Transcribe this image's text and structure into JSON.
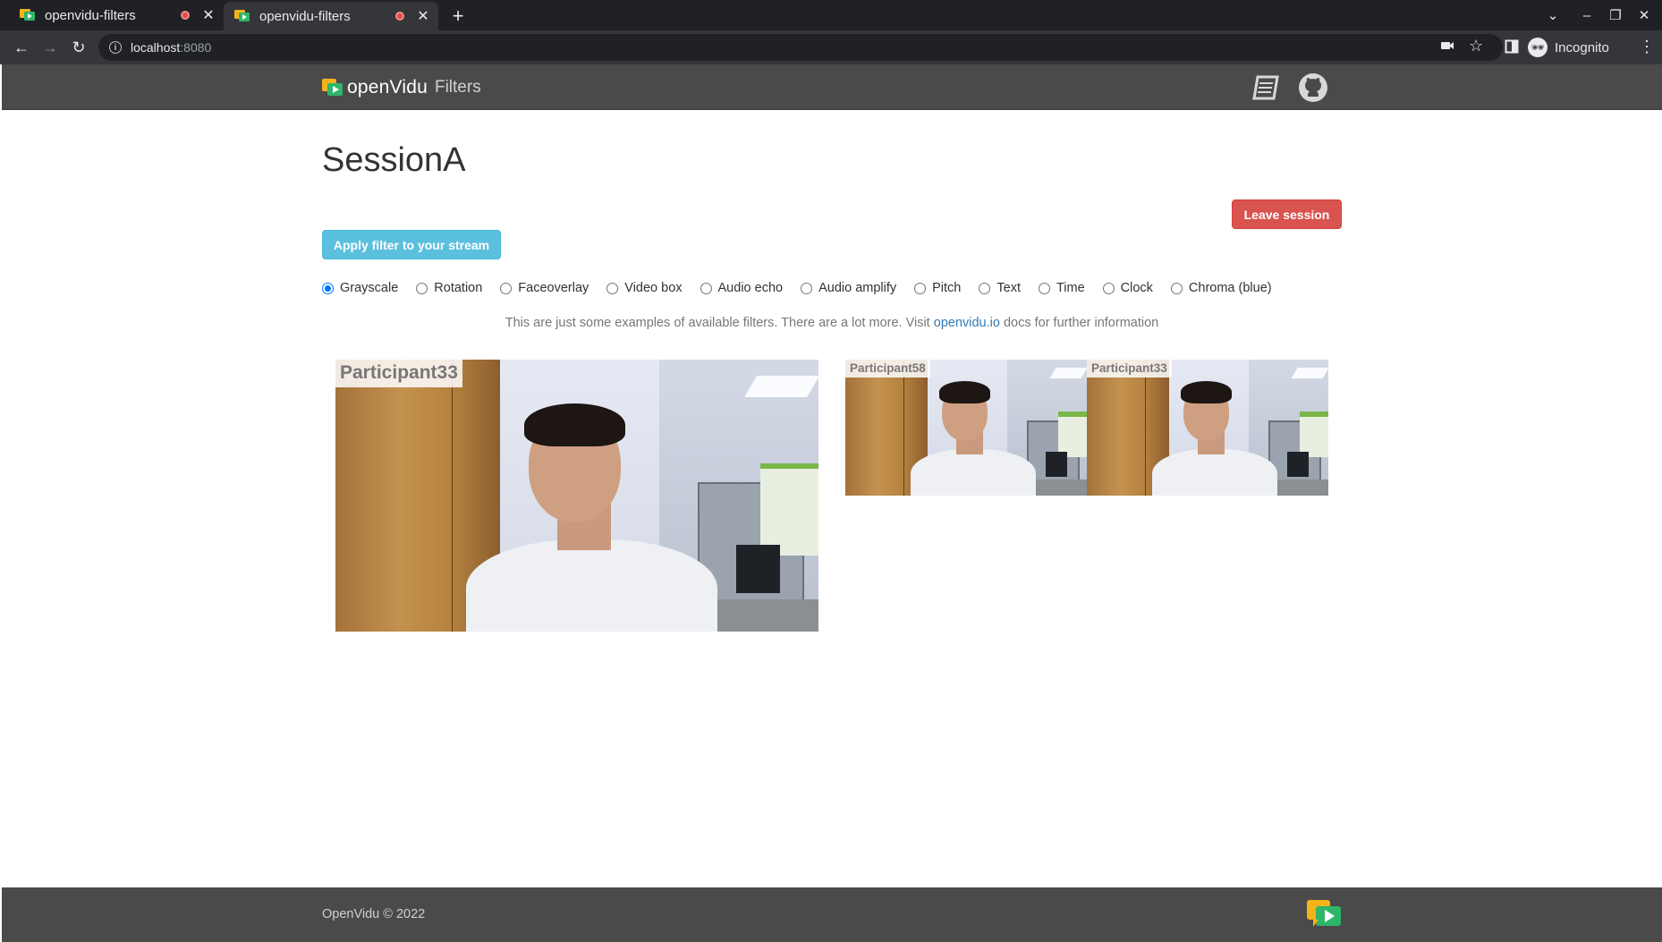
{
  "browser": {
    "tabs": [
      {
        "title": "openvidu-filters",
        "active": false
      },
      {
        "title": "openvidu-filters",
        "active": true
      }
    ],
    "new_tab_label": "+",
    "url_host": "localhost",
    "url_port": ":8080",
    "profile_label": "Incognito"
  },
  "navbar": {
    "brand_wordmark": "openVidu",
    "brand_sub": "Filters",
    "icons": [
      "docs-book-icon",
      "github-icon"
    ]
  },
  "session": {
    "title": "SessionA",
    "leave_label": "Leave session",
    "apply_filter_label": "Apply filter to your stream"
  },
  "filters": {
    "selected": "Grayscale",
    "options": [
      "Grayscale",
      "Rotation",
      "Faceoverlay",
      "Video box",
      "Audio echo",
      "Audio amplify",
      "Pitch",
      "Text",
      "Time",
      "Clock",
      "Chroma (blue)"
    ]
  },
  "hint": {
    "before": "This are just some examples of available filters. There are a lot more. Visit ",
    "link": "openvidu.io",
    "after": " docs for further information"
  },
  "videos": {
    "main": {
      "nickname": "Participant33"
    },
    "remote": [
      {
        "nickname": "Participant58"
      },
      {
        "nickname": "Participant33"
      }
    ]
  },
  "footer": {
    "copyright": "OpenVidu © 2022"
  },
  "colors": {
    "navbar_bg": "#4a4a4a",
    "leave_button": "#d9534f",
    "filter_button": "#5bc0de",
    "link": "#337ab7",
    "radio_accent": "#0075ff"
  }
}
